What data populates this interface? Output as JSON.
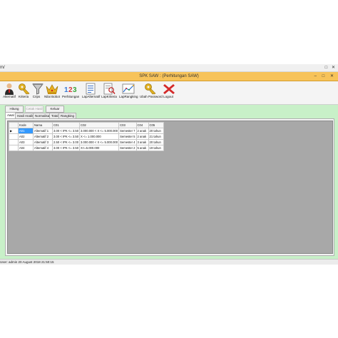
{
  "menu": {
    "left_text": "m/",
    "right_glyphs": "□ ✕"
  },
  "window": {
    "title": "SPK SAW : (Perhitungan SAW)",
    "controls": "– □ ✕"
  },
  "toolbar": {
    "items": [
      {
        "label": "Alternatif",
        "icon": "user-icon"
      },
      {
        "label": "Kriteria",
        "icon": "key-icon"
      },
      {
        "label": "Crips",
        "icon": "funnel-icon"
      },
      {
        "label": "Nilai Bobot",
        "icon": "crown-icon"
      },
      {
        "label": "Perhitungan",
        "icon": "numbers-icon"
      },
      {
        "label": "LapAlternatif",
        "icon": "report-icon"
      },
      {
        "label": "LapKriteria",
        "icon": "report-search-icon"
      },
      {
        "label": "LapRangking",
        "icon": "chart-icon"
      },
      {
        "label": "Ubah Password",
        "icon": "key-icon"
      },
      {
        "label": "Logout",
        "icon": "close-icon"
      }
    ]
  },
  "actions": {
    "hitung": "Hitung",
    "cetak": "Cetak Hasil",
    "keluar": "Keluar"
  },
  "tabs": [
    "Awal",
    "Hasil Analisa",
    "Normalisasi",
    "Total",
    "Rangking"
  ],
  "table": {
    "headers": [
      "Kode",
      "Nama",
      "C01",
      "C02",
      "C03",
      "C04",
      "C05"
    ],
    "rows": [
      [
        "A01",
        "Alternatif 1",
        "3.00 < IPK <= 3.50",
        "3.000.000 < X <= 5.000.000",
        "Semester 7",
        "2 anak",
        "20 tahun"
      ],
      [
        "A02",
        "Alternatif 2",
        "3.00 < IPK <= 3.50",
        "X <= 1.000.000",
        "Semester 5",
        "2 anak",
        "21 tahun"
      ],
      [
        "A03",
        "Alternatif 3",
        "2.50 < IPK <= 3.00",
        "3.000.000 < X <= 5.000.000",
        "Semester 4",
        "3 anak",
        "20 tahun"
      ],
      [
        "A04",
        "Alternatif 4",
        "3.00 < IPK <= 3.50",
        "X<=5.000.000",
        "Semester 2",
        "5 anak",
        "19 tahun"
      ]
    ],
    "row_pointer": "▶"
  },
  "status": {
    "text": "User: admin  20 August 2018 21:50:15"
  },
  "colors": {
    "title_bar": "#f7c35a",
    "main_bg": "#c8f0c8",
    "grid_bg": "#a8a8a8",
    "selection": "#3399ff"
  }
}
